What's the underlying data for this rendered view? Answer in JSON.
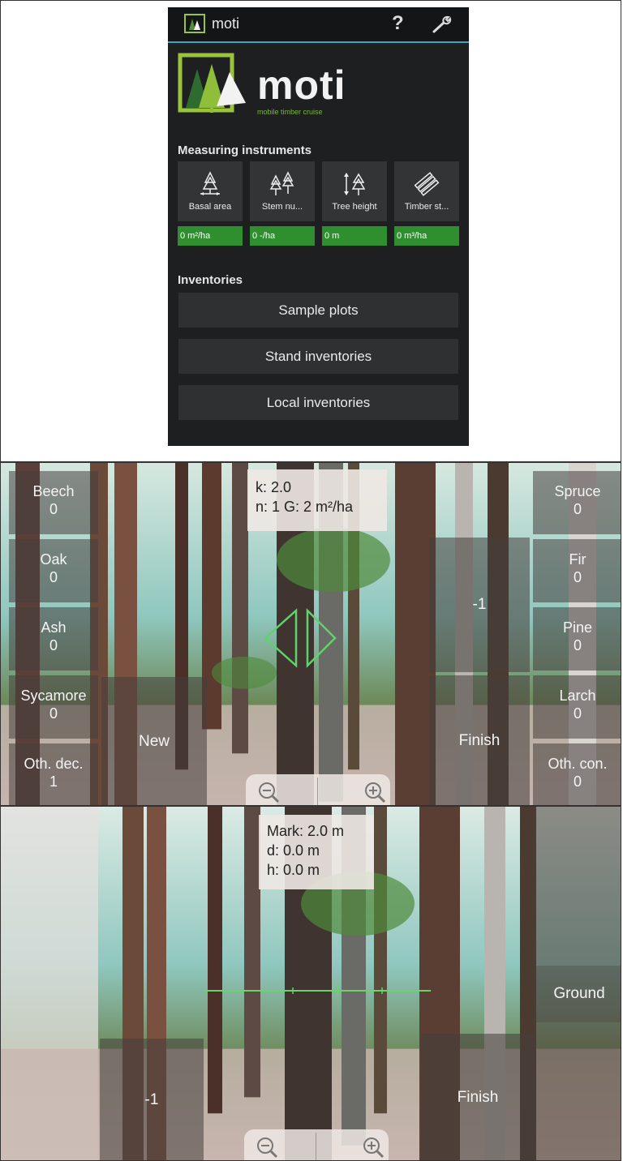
{
  "app": {
    "title": "moti",
    "help_label": "?",
    "brand_name": "moti",
    "brand_tagline": "mobile timber cruise"
  },
  "measuring": {
    "heading": "Measuring instruments",
    "tiles": [
      {
        "label": "Basal area",
        "value": "0 m²/ha",
        "icon": "basal-area-icon"
      },
      {
        "label": "Stem nu...",
        "value": "0 -/ha",
        "icon": "stem-number-icon"
      },
      {
        "label": "Tree height",
        "value": "0 m",
        "icon": "tree-height-icon"
      },
      {
        "label": "Timber st...",
        "value": "0 m³/ha",
        "icon": "timber-stock-icon"
      }
    ]
  },
  "inventories": {
    "heading": "Inventories",
    "buttons": [
      "Sample plots",
      "Stand inventories",
      "Local inventories"
    ]
  },
  "basal_area_view": {
    "info_k": "k: 2.0",
    "info_n": "n: 1   G: 2 m²/ha",
    "left_species": [
      {
        "name": "Beech",
        "count": "0"
      },
      {
        "name": "Oak",
        "count": "0"
      },
      {
        "name": "Ash",
        "count": "0"
      },
      {
        "name": "Sycamore",
        "count": "0"
      },
      {
        "name": "Oth. dec.",
        "count": "1"
      }
    ],
    "right_species": [
      {
        "name": "Spruce",
        "count": "0"
      },
      {
        "name": "Fir",
        "count": "0"
      },
      {
        "name": "Pine",
        "count": "0"
      },
      {
        "name": "Larch",
        "count": "0"
      },
      {
        "name": "Oth. con.",
        "count": "0"
      }
    ],
    "new_label": "New",
    "minus_label": "-1",
    "finish_label": "Finish"
  },
  "height_view": {
    "mark": "Mark: 2.0 m",
    "d": "d: 0.0 m",
    "h": "h: 0.0 m",
    "minus_label": "-1",
    "finish_label": "Finish",
    "ground_label": "Ground"
  },
  "colors": {
    "accent_green": "#2f8f2f",
    "action_bar_line": "#3aa3c7",
    "logo_green": "#7bb83a"
  }
}
